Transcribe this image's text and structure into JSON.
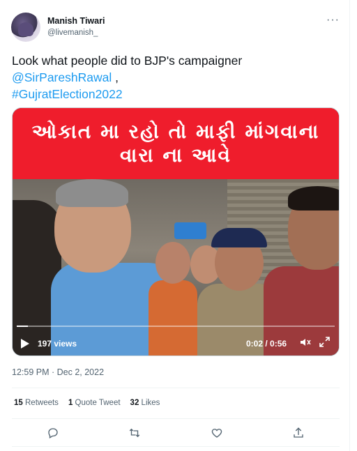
{
  "author": {
    "name": "Manish Tiwari",
    "handle": "@livemanish_"
  },
  "menu_glyph": "···",
  "tweet": {
    "text_plain": "Look what people did to BJP's campaigner",
    "mention": "@SirPareshRawal",
    "text_sep": " ,",
    "hashtag": "#GujratElection2022"
  },
  "media": {
    "caption_line1": "ઓકાત મા રહો તો માફી માંગવાના",
    "caption_line2": "વારા ના આવે",
    "views": "197 views",
    "time": "0:02 / 0:56",
    "progress_fraction": 0.036
  },
  "timestamp": "12:59 PM · Dec 2, 2022",
  "stats": {
    "retweets_count": "15",
    "retweets_label": "Retweets",
    "quotes_count": "1",
    "quotes_label": "Quote Tweet",
    "likes_count": "32",
    "likes_label": "Likes"
  },
  "icons": [
    "reply-icon",
    "retweet-icon",
    "like-icon",
    "share-icon"
  ],
  "colors": {
    "link": "#1d9bf0",
    "banner": "#ef1d2c",
    "muted": "#536471"
  }
}
